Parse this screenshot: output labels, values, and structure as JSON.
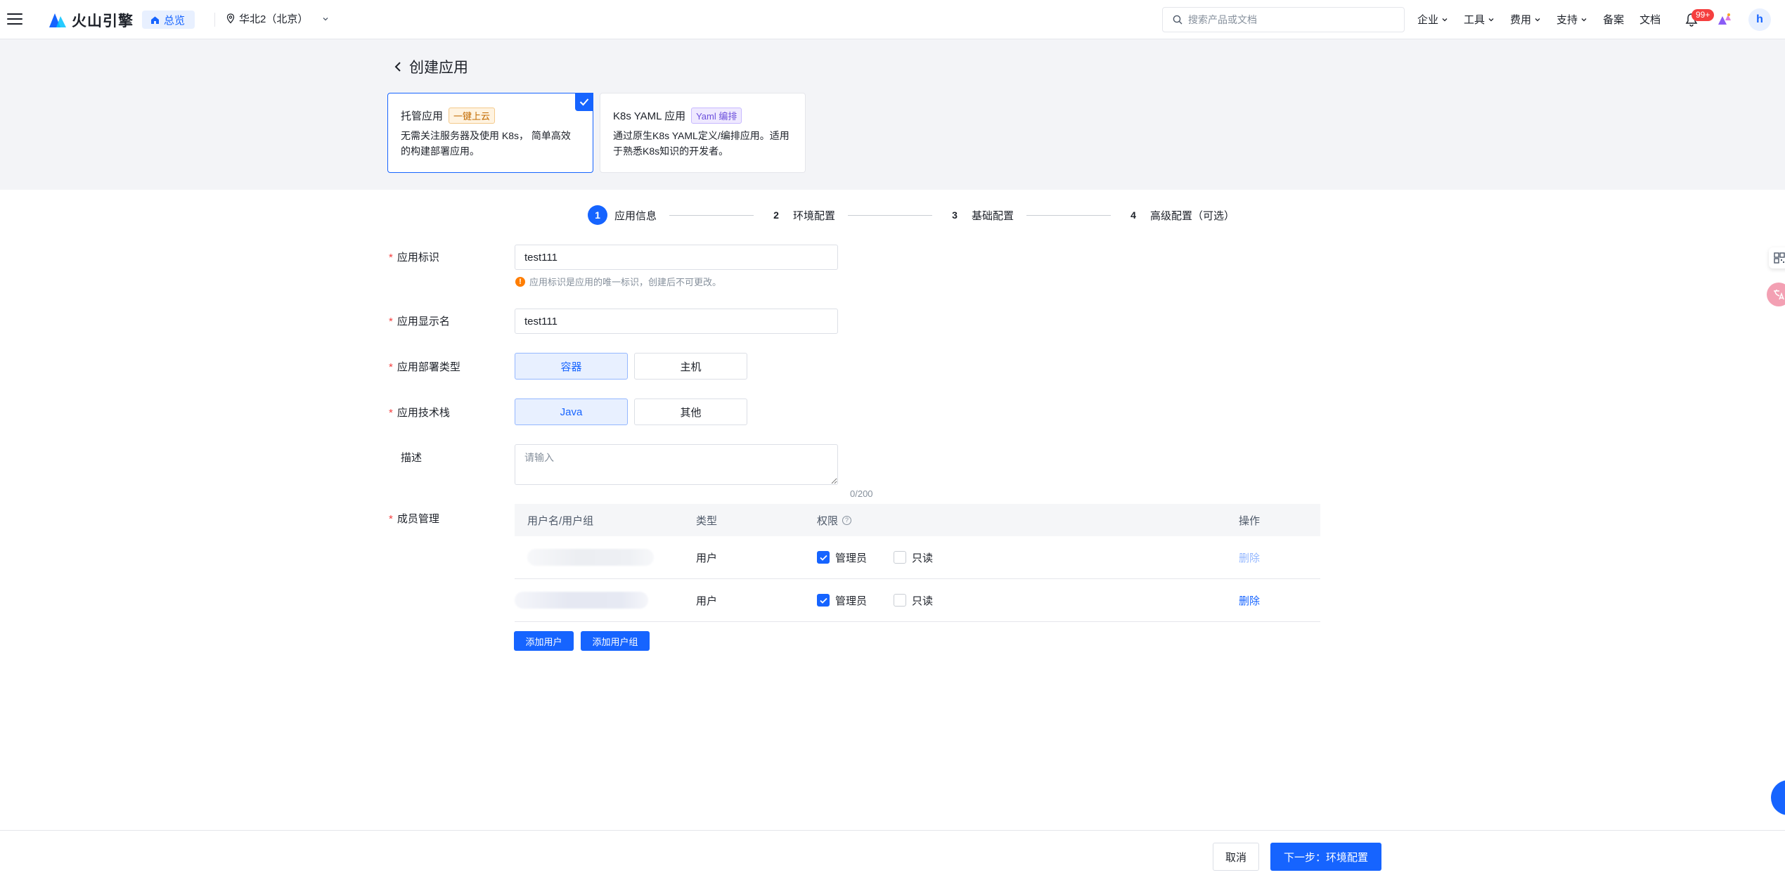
{
  "topbar": {
    "logo_text": "火山引擎",
    "home_label": "总览",
    "region_label": "华北2（北京）",
    "search_placeholder": "搜索产品或文档",
    "nav": [
      {
        "label": "企业",
        "dropdown": true
      },
      {
        "label": "工具",
        "dropdown": true
      },
      {
        "label": "费用",
        "dropdown": true
      },
      {
        "label": "支持",
        "dropdown": true
      },
      {
        "label": "备案",
        "dropdown": false
      },
      {
        "label": "文档",
        "dropdown": false
      }
    ],
    "notification_badge": "99+",
    "avatar_letter": "h"
  },
  "page": {
    "title": "创建应用"
  },
  "cards": [
    {
      "title": "托管应用",
      "tag": "一键上云",
      "desc": "无需关注服务器及使用 K8s， 简单高效的构建部署应用。",
      "selected": true
    },
    {
      "title": "K8s YAML 应用",
      "tag": "Yaml 编排",
      "desc": "通过原生K8s YAML定义/编排应用。适用于熟悉K8s知识的开发者。",
      "selected": false
    }
  ],
  "steps": [
    {
      "num": "1",
      "label": "应用信息",
      "active": true
    },
    {
      "num": "2",
      "label": "环境配置",
      "active": false
    },
    {
      "num": "3",
      "label": "基础配置",
      "active": false
    },
    {
      "num": "4",
      "label": "高级配置（可选）",
      "active": false
    }
  ],
  "form": {
    "app_id": {
      "label": "应用标识",
      "value": "test111",
      "hint": "应用标识是应用的唯一标识，创建后不可更改。"
    },
    "display_name": {
      "label": "应用显示名",
      "value": "test111"
    },
    "deploy_type": {
      "label": "应用部署类型",
      "options": [
        "容器",
        "主机"
      ],
      "selected": "容器"
    },
    "tech_stack": {
      "label": "应用技术栈",
      "options": [
        "Java",
        "其他"
      ],
      "selected": "Java"
    },
    "description": {
      "label": "描述",
      "placeholder": "请输入",
      "counter": "0/200"
    },
    "members": {
      "label": "成员管理",
      "headers": [
        "用户名/用户组",
        "类型",
        "权限",
        "操作"
      ],
      "rows": [
        {
          "type": "用户",
          "admin_label": "管理员",
          "admin": true,
          "readonly_label": "只读",
          "readonly": false,
          "action": "删除",
          "action_disabled": true
        },
        {
          "type": "用户",
          "admin_label": "管理员",
          "admin": true,
          "readonly_label": "只读",
          "readonly": false,
          "action": "删除",
          "action_disabled": false
        }
      ],
      "add_user": "添加用户",
      "add_group": "添加用户组"
    }
  },
  "footer": {
    "cancel": "取消",
    "next": "下一步：环境配置"
  },
  "colors": {
    "primary": "#1664ff",
    "danger": "#f53f3f",
    "warning": "#ff7d00"
  }
}
